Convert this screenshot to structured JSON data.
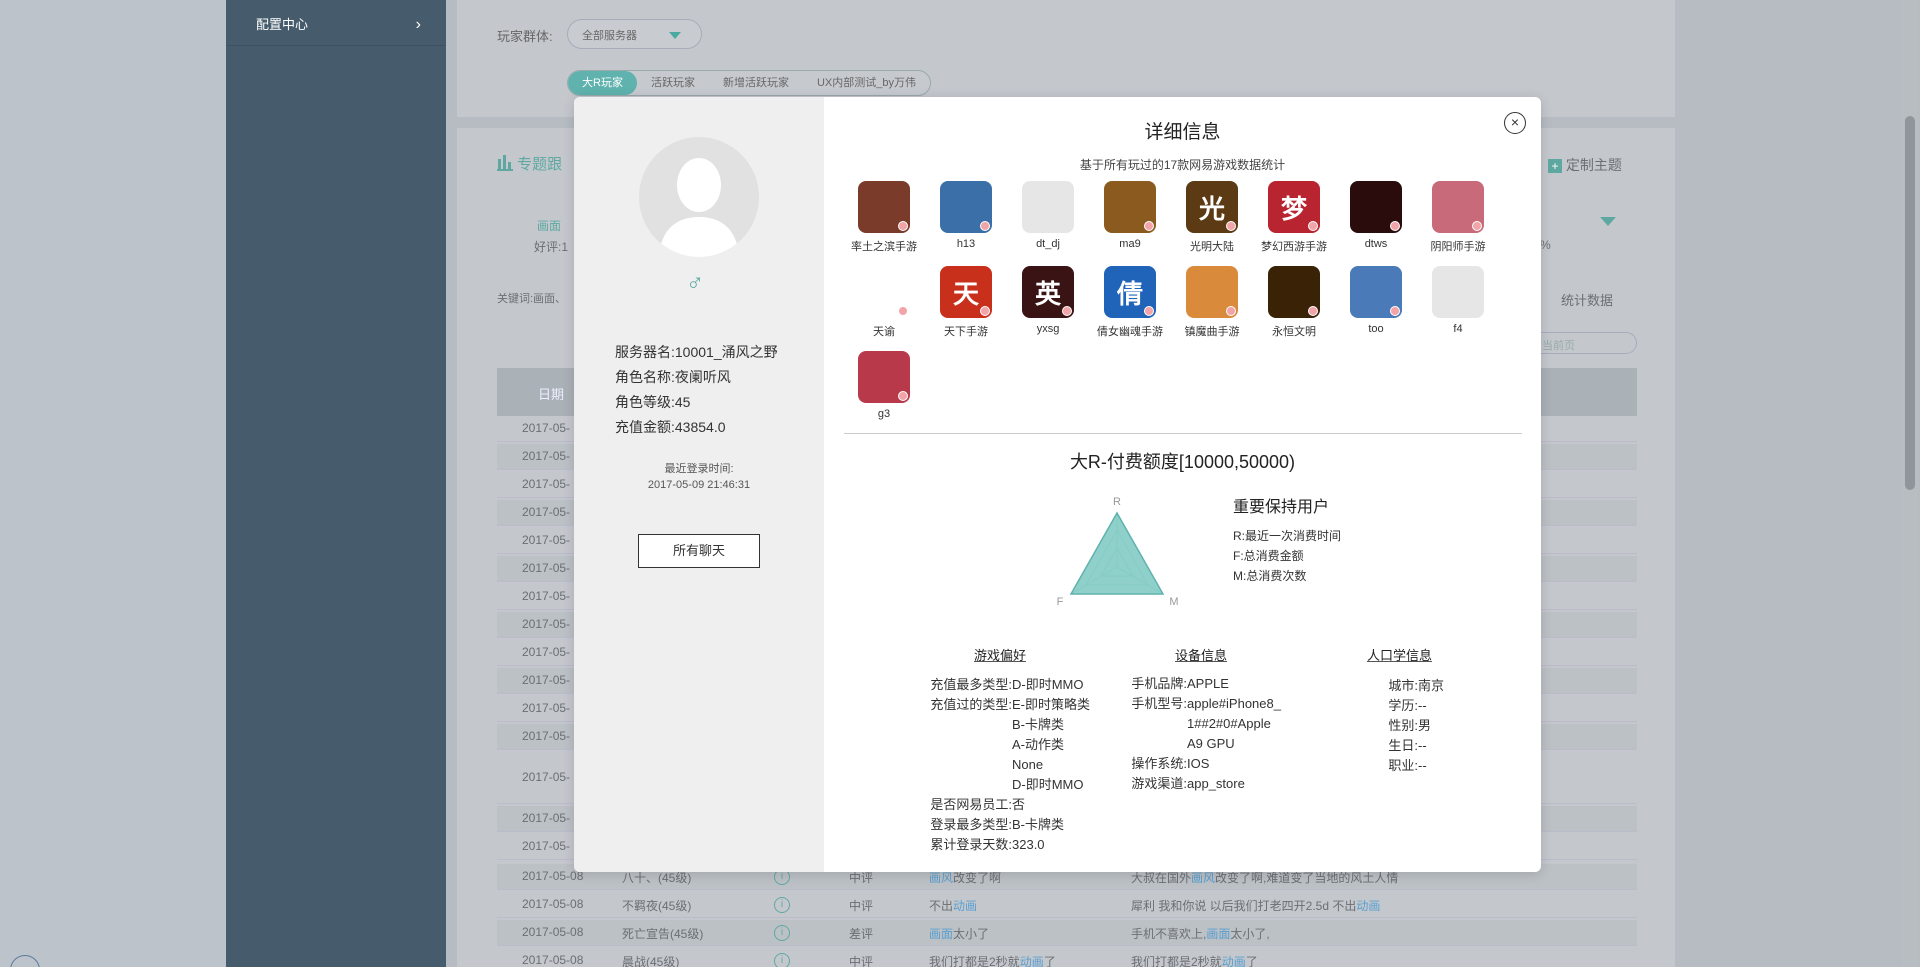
{
  "sidebar": {
    "items": [
      {
        "label": "配置中心"
      }
    ]
  },
  "background": {
    "filter_label": "玩家群体:",
    "server_select": "全部服务器",
    "tabs": [
      "大R玩家",
      "活跃玩家",
      "新增活跃玩家",
      "UX内部测试_by万伟"
    ],
    "topic_label": "专题跟",
    "custom_theme": "定制主题",
    "dim_label": "画面",
    "good_label": "好评:1",
    "keyword_label": "关键词:画面、",
    "percent": "%",
    "stats_btn": "统计数据",
    "search_placeholder": "索当前页",
    "date_header": "日期",
    "date_rows": [
      "2017-05-",
      "2017-05-",
      "2017-05-",
      "2017-05-",
      "2017-05-",
      "2017-05-",
      "2017-05-",
      "2017-05-",
      "2017-05-",
      "2017-05-",
      "2017-05-",
      "2017-05-",
      "2017-05-",
      "2017-05-",
      "2017-05-"
    ],
    "full_rows": [
      {
        "date": "2017-05-08",
        "player": "八十、(45级)",
        "rating": "中评",
        "c1a": "画风",
        "c1b": "改变了啊",
        "c2a": "大叔在国外",
        "c2b": "画风",
        "c2c": "改变了啊,难道变了当地的风土人情"
      },
      {
        "date": "2017-05-08",
        "player": "不羁夜(45级)",
        "rating": "中评",
        "c1a": "不出",
        "c1b": "动画",
        "c2a": "犀利 我和你说 以后我们打老四开2.5d 不出",
        "c2b": "动画",
        "c2c": ""
      },
      {
        "date": "2017-05-08",
        "player": "死亡宣告(45级)",
        "rating": "差评",
        "c1a": "画面",
        "c1b": "太小了",
        "c2a": "手机不喜欢上,",
        "c2b": "画面",
        "c2c": "太小了,"
      },
      {
        "date": "2017-05-08",
        "player": "晨战(45级)",
        "rating": "中评",
        "c1a": "我们打都是2秒就",
        "c1b": "动画",
        "c2a": "我们打都是2秒就",
        "c2b": "动画",
        "c2c": "了"
      }
    ]
  },
  "modal": {
    "title": "详细信息",
    "subtitle": "基于所有玩过的17款网易游戏数据统计",
    "gender_symbol": "♂",
    "server": "服务器名:10001_涌风之野",
    "role_name": "角色名称:夜阑听风",
    "role_level": "角色等级:45",
    "recharge": "充值金额:43854.0",
    "last_login_label": "最近登录时间:",
    "last_login_time": "2017-05-09 21:46:31",
    "chat_button": "所有聊天",
    "close_symbol": "×",
    "games": [
      {
        "name": "率土之滨手游",
        "color": "#7a3b2a",
        "glyph": ""
      },
      {
        "name": "h13",
        "color": "#3a6fa8",
        "glyph": ""
      },
      {
        "name": "dt_dj",
        "color": "#e6e6e6",
        "glyph": ""
      },
      {
        "name": "ma9",
        "color": "#8a5a1e",
        "glyph": ""
      },
      {
        "name": "光明大陆",
        "color": "#5b3a14",
        "glyph": "光"
      },
      {
        "name": "梦幻西游手游",
        "color": "#b8242f",
        "glyph": "梦"
      },
      {
        "name": "dtws",
        "color": "#2a0c0c",
        "glyph": ""
      },
      {
        "name": "阴阳师手游",
        "color": "#c86a7a",
        "glyph": ""
      },
      {
        "name": "天谕",
        "color": "#ffffff",
        "glyph": ""
      },
      {
        "name": "天下手游",
        "color": "#c8301c",
        "glyph": "天"
      },
      {
        "name": "yxsg",
        "color": "#3a1414",
        "glyph": "英"
      },
      {
        "name": "倩女幽魂手游",
        "color": "#1f64b8",
        "glyph": "倩"
      },
      {
        "name": "镇魔曲手游",
        "color": "#d98a3a",
        "glyph": ""
      },
      {
        "name": "永恒文明",
        "color": "#3a2206",
        "glyph": ""
      },
      {
        "name": "too",
        "color": "#4a7ab8",
        "glyph": ""
      },
      {
        "name": "f4",
        "color": "#e6e6e6",
        "glyph": ""
      },
      {
        "name": "g3",
        "color": "#b83a4a",
        "glyph": ""
      }
    ],
    "rfm": {
      "title": "大R-付费额度[10000,50000)",
      "level": "重要保持用户",
      "axis_r": "R",
      "axis_f": "F",
      "axis_m": "M",
      "legend_r": "R:最近一次消费时间",
      "legend_f": "F:总消费金额",
      "legend_m": "M:总消费次数",
      "accent": "#7cc8c2"
    },
    "game_pref": {
      "title": "游戏偏好",
      "rows": [
        {
          "k": "充值最多类型:",
          "v": "D-即时MMO"
        },
        {
          "k": "充值过的类型:",
          "v": "E-即时策略类\nB-卡牌类\nA-动作类\nNone\nD-即时MMO"
        },
        {
          "k": "是否网易员工:",
          "v": "否"
        },
        {
          "k": "登录最多类型:",
          "v": "B-卡牌类"
        },
        {
          "k": "累计登录天数:",
          "v": "323.0"
        }
      ]
    },
    "device": {
      "title": "设备信息",
      "rows": [
        {
          "k": "手机品牌:",
          "v": "APPLE"
        },
        {
          "k": "手机型号:",
          "v": "apple#iPhone8_\n1##2#0#Apple\nA9 GPU"
        },
        {
          "k": "操作系统:",
          "v": "IOS"
        },
        {
          "k": "游戏渠道:",
          "v": "app_store"
        }
      ]
    },
    "demographics": {
      "title": "人口学信息",
      "rows": [
        {
          "k": "城市:",
          "v": "南京"
        },
        {
          "k": "学历:",
          "v": "--"
        },
        {
          "k": "性别:",
          "v": "男"
        },
        {
          "k": "生日:",
          "v": "--"
        },
        {
          "k": "职业:",
          "v": "--"
        }
      ]
    }
  }
}
